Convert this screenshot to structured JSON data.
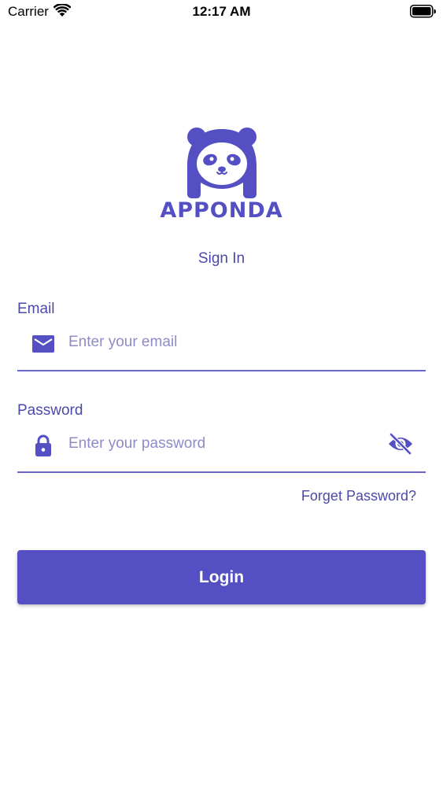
{
  "status_bar": {
    "carrier": "Carrier",
    "time": "12:17 AM"
  },
  "logo": {
    "text": "APPONDA",
    "icon": "panda-logo-icon"
  },
  "title": "Sign In",
  "email": {
    "label": "Email",
    "placeholder": "Enter your email",
    "value": "",
    "icon": "mail-icon"
  },
  "password": {
    "label": "Password",
    "placeholder": "Enter your password",
    "value": "",
    "icon": "lock-icon",
    "toggle_icon": "eye-off-icon"
  },
  "forget_password": "Forget Password?",
  "login_button": "Login",
  "colors": {
    "accent": "#5450c4",
    "label": "#4d49a8",
    "placeholder": "#8f8bc6"
  }
}
